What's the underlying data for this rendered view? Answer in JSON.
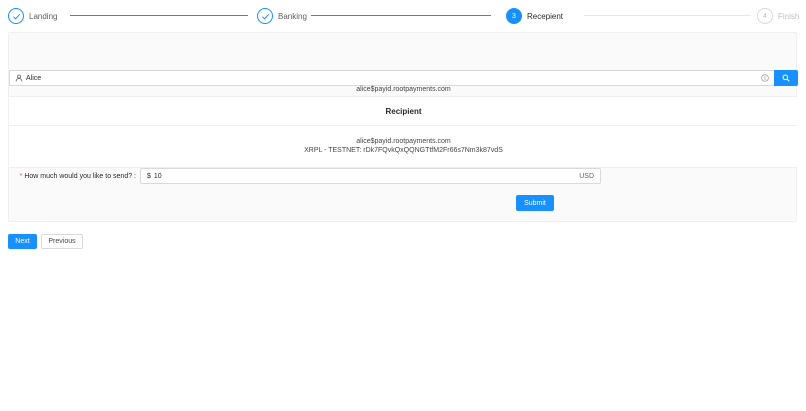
{
  "steps": [
    {
      "number": "",
      "title": "Landing",
      "status": "done"
    },
    {
      "number": "",
      "title": "Banking",
      "status": "done"
    },
    {
      "number": "3",
      "title": "Recepient",
      "status": "active"
    },
    {
      "number": "4",
      "title": "Finish",
      "status": "wait"
    }
  ],
  "search": {
    "value": "Alice",
    "user_icon": "user-icon",
    "info_icon": "info-icon",
    "button_icon": "search-icon"
  },
  "resolved_address": "alice$payid.rootpayments.com",
  "recipient_card": {
    "title": "Recipient",
    "payid": "alice$payid.rootpayments.com",
    "xrpl_address": "XRPL - TESTNET: rDk7FQvkQxQQNGTtfM2Fr66s7Nm3k87vdS"
  },
  "amount_field": {
    "label": "How much would you like to send? :",
    "required_mark": "*",
    "prefix": "$",
    "value": "10",
    "suffix": "USD"
  },
  "submit_label": "Submit",
  "nav": {
    "next_label": "Next",
    "previous_label": "Previous"
  },
  "colors": {
    "primary": "#1890ff",
    "panel_bg": "#fafafa",
    "required": "#ff4d4f"
  }
}
